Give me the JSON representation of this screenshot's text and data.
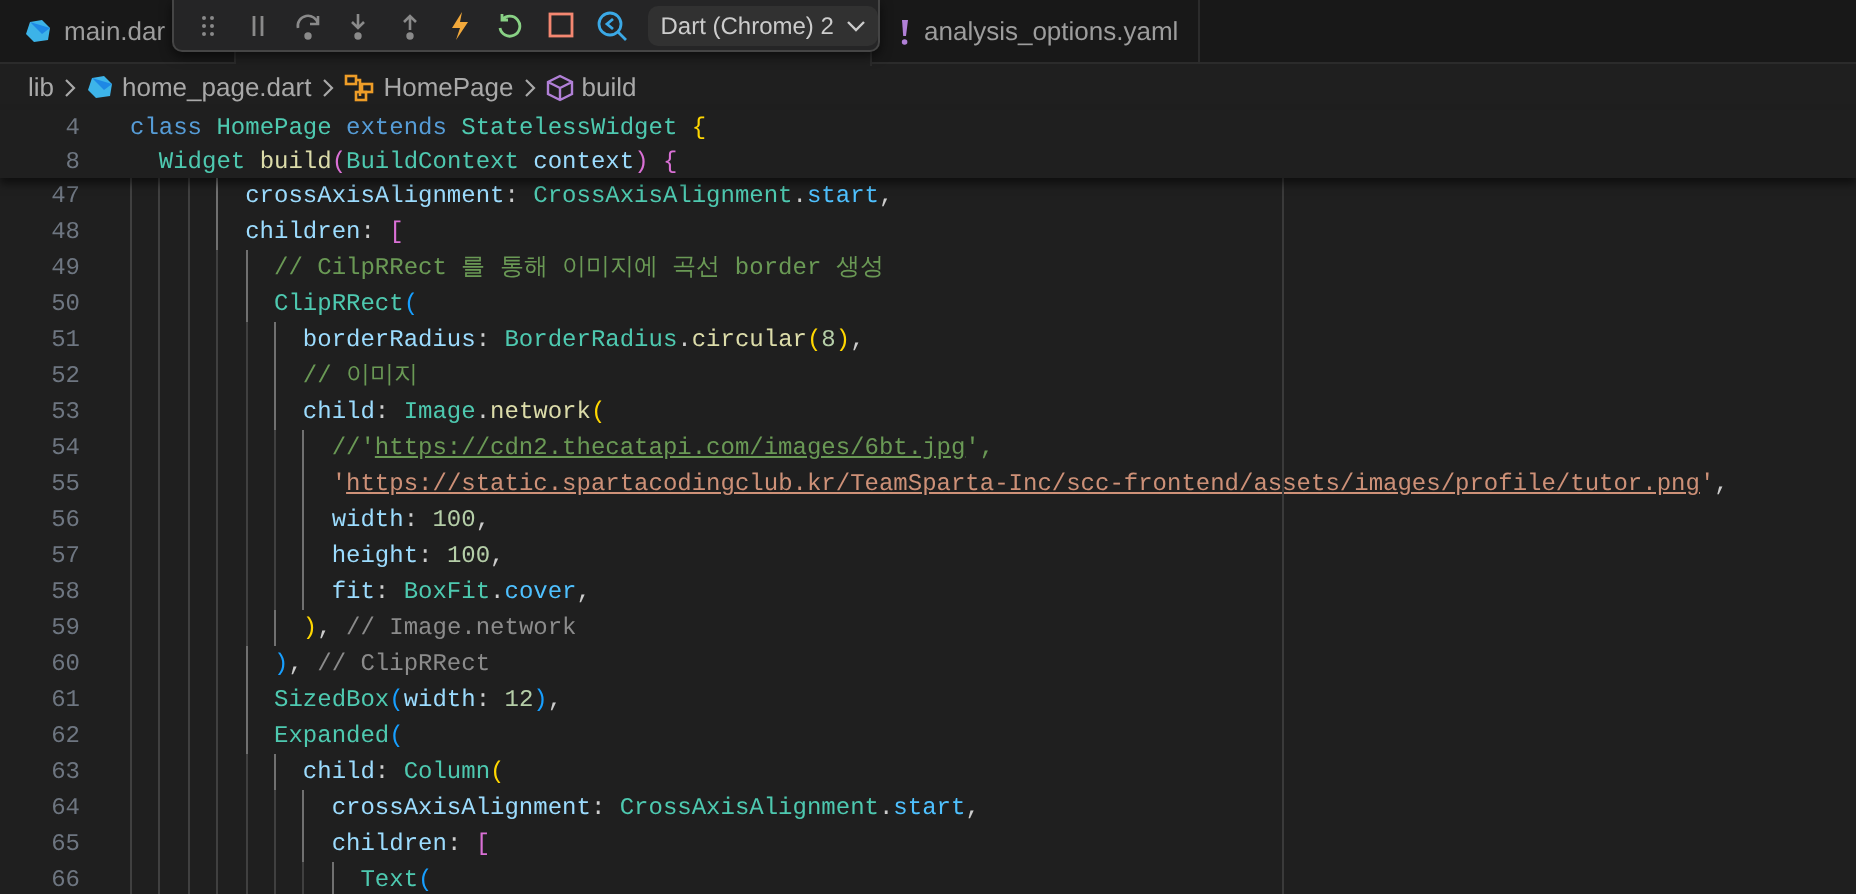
{
  "tabs": [
    {
      "label": "main.dar",
      "selected": false,
      "kind": "dart"
    },
    {
      "label": "analysis_options.yaml",
      "selected": false,
      "kind": "yaml"
    }
  ],
  "debug_toolbar": {
    "session": "Dart (Chrome) 2"
  },
  "breadcrumbs": [
    {
      "label": "lib",
      "kind": "folder"
    },
    {
      "label": "home_page.dart",
      "kind": "dart"
    },
    {
      "label": "HomePage",
      "kind": "class"
    },
    {
      "label": "build",
      "kind": "method"
    }
  ],
  "sticky_lines": [
    {
      "number": "4",
      "tokens": [
        {
          "text": "class ",
          "kind": "kw"
        },
        {
          "text": "HomePage ",
          "kind": "type"
        },
        {
          "text": "extends ",
          "kind": "kw"
        },
        {
          "text": "StatelessWidget ",
          "kind": "type"
        },
        {
          "text": "{",
          "kind": "b1"
        }
      ]
    },
    {
      "number": "8",
      "tokens": [
        {
          "text": "  Widget ",
          "kind": "type"
        },
        {
          "text": "build",
          "kind": "fn"
        },
        {
          "text": "(",
          "kind": "b2"
        },
        {
          "text": "BuildContext ",
          "kind": "type"
        },
        {
          "text": "context",
          "kind": "prop"
        },
        {
          "text": ") {",
          "kind": "b2"
        }
      ]
    }
  ],
  "lines": [
    {
      "number": "47",
      "tokens": [
        {
          "text": "        crossAxisAlignment",
          "kind": "prop"
        },
        {
          "text": ": ",
          "kind": "p"
        },
        {
          "text": "CrossAxisAlignment",
          "kind": "type"
        },
        {
          "text": ".",
          "kind": "p"
        },
        {
          "text": "start",
          "kind": "enum"
        },
        {
          "text": ",",
          "kind": "p"
        }
      ]
    },
    {
      "number": "48",
      "tokens": [
        {
          "text": "        children",
          "kind": "prop"
        },
        {
          "text": ": ",
          "kind": "p"
        },
        {
          "text": "[",
          "kind": "b2"
        }
      ]
    },
    {
      "number": "49",
      "tokens": [
        {
          "text": "          // CilpRRect 를 통해 이미지에 곡선 border 생성",
          "kind": "comment"
        }
      ]
    },
    {
      "number": "50",
      "tokens": [
        {
          "text": "          ClipRRect",
          "kind": "type"
        },
        {
          "text": "(",
          "kind": "b3"
        }
      ]
    },
    {
      "number": "51",
      "tokens": [
        {
          "text": "            borderRadius",
          "kind": "prop"
        },
        {
          "text": ": ",
          "kind": "p"
        },
        {
          "text": "BorderRadius",
          "kind": "type"
        },
        {
          "text": ".",
          "kind": "p"
        },
        {
          "text": "circular",
          "kind": "fn"
        },
        {
          "text": "(",
          "kind": "b1"
        },
        {
          "text": "8",
          "kind": "num"
        },
        {
          "text": ")",
          "kind": "b1"
        },
        {
          "text": ",",
          "kind": "p"
        }
      ]
    },
    {
      "number": "52",
      "tokens": [
        {
          "text": "            // 이미지",
          "kind": "comment"
        }
      ]
    },
    {
      "number": "53",
      "tokens": [
        {
          "text": "            child",
          "kind": "prop"
        },
        {
          "text": ": ",
          "kind": "p"
        },
        {
          "text": "Image",
          "kind": "type"
        },
        {
          "text": ".",
          "kind": "p"
        },
        {
          "text": "network",
          "kind": "fn"
        },
        {
          "text": "(",
          "kind": "b1"
        }
      ]
    },
    {
      "number": "54",
      "tokens": [
        {
          "text": "              //'",
          "kind": "comment"
        },
        {
          "text": "https://cdn2.thecatapi.com/images/6bt.jpg",
          "kind": "comment_link"
        },
        {
          "text": "',",
          "kind": "comment"
        }
      ]
    },
    {
      "number": "55",
      "tokens": [
        {
          "text": "              '",
          "kind": "str"
        },
        {
          "text": "https://static.spartacodingclub.kr/TeamSparta-Inc/scc-frontend/assets/images/profile/tutor.png",
          "kind": "str_link"
        },
        {
          "text": "'",
          "kind": "str"
        },
        {
          "text": ",",
          "kind": "p"
        }
      ]
    },
    {
      "number": "56",
      "tokens": [
        {
          "text": "              width",
          "kind": "prop"
        },
        {
          "text": ": ",
          "kind": "p"
        },
        {
          "text": "100",
          "kind": "num"
        },
        {
          "text": ",",
          "kind": "p"
        }
      ]
    },
    {
      "number": "57",
      "tokens": [
        {
          "text": "              height",
          "kind": "prop"
        },
        {
          "text": ": ",
          "kind": "p"
        },
        {
          "text": "100",
          "kind": "num"
        },
        {
          "text": ",",
          "kind": "p"
        }
      ]
    },
    {
      "number": "58",
      "tokens": [
        {
          "text": "              fit",
          "kind": "prop"
        },
        {
          "text": ": ",
          "kind": "p"
        },
        {
          "text": "BoxFit",
          "kind": "type"
        },
        {
          "text": ".",
          "kind": "p"
        },
        {
          "text": "cover",
          "kind": "enum"
        },
        {
          "text": ",",
          "kind": "p"
        }
      ]
    },
    {
      "number": "59",
      "tokens": [
        {
          "text": "            )",
          "kind": "b1"
        },
        {
          "text": ",",
          "kind": "p"
        },
        {
          "text": " // Image.network",
          "kind": "label"
        }
      ]
    },
    {
      "number": "60",
      "tokens": [
        {
          "text": "          )",
          "kind": "b3"
        },
        {
          "text": ",",
          "kind": "p"
        },
        {
          "text": " // ClipRRect",
          "kind": "label"
        }
      ]
    },
    {
      "number": "61",
      "tokens": [
        {
          "text": "          SizedBox",
          "kind": "type"
        },
        {
          "text": "(",
          "kind": "b3"
        },
        {
          "text": "width",
          "kind": "prop"
        },
        {
          "text": ": ",
          "kind": "p"
        },
        {
          "text": "12",
          "kind": "num"
        },
        {
          "text": ")",
          "kind": "b3"
        },
        {
          "text": ",",
          "kind": "p"
        }
      ]
    },
    {
      "number": "62",
      "tokens": [
        {
          "text": "          Expanded",
          "kind": "type"
        },
        {
          "text": "(",
          "kind": "b3"
        }
      ]
    },
    {
      "number": "63",
      "tokens": [
        {
          "text": "            child",
          "kind": "prop"
        },
        {
          "text": ": ",
          "kind": "p"
        },
        {
          "text": "Column",
          "kind": "type"
        },
        {
          "text": "(",
          "kind": "b1"
        }
      ]
    },
    {
      "number": "64",
      "tokens": [
        {
          "text": "              crossAxisAlignment",
          "kind": "prop"
        },
        {
          "text": ": ",
          "kind": "p"
        },
        {
          "text": "CrossAxisAlignment",
          "kind": "type"
        },
        {
          "text": ".",
          "kind": "p"
        },
        {
          "text": "start",
          "kind": "enum"
        },
        {
          "text": ",",
          "kind": "p"
        }
      ]
    },
    {
      "number": "65",
      "tokens": [
        {
          "text": "              children",
          "kind": "prop"
        },
        {
          "text": ": ",
          "kind": "p"
        },
        {
          "text": "[",
          "kind": "b2"
        }
      ]
    },
    {
      "number": "66",
      "tokens": [
        {
          "text": "                Text",
          "kind": "type"
        },
        {
          "text": "(",
          "kind": "b3"
        }
      ]
    }
  ]
}
